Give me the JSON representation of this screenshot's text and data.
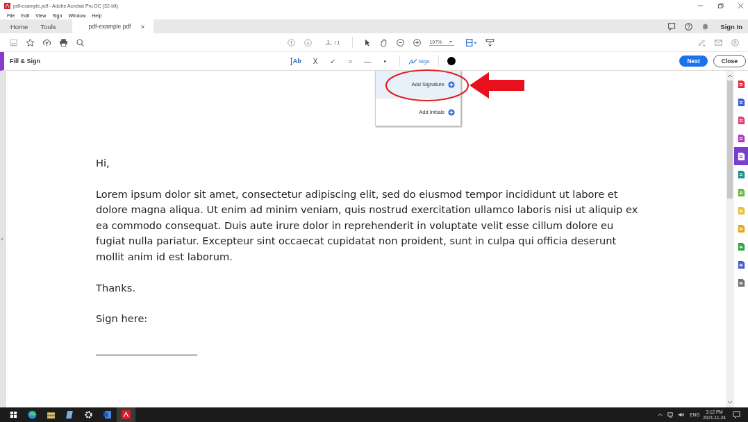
{
  "window": {
    "title": "pdf-example.pdf - Adobe Acrobat Pro DC (32-bit)"
  },
  "menu": [
    "File",
    "Edit",
    "View",
    "Sign",
    "Window",
    "Help"
  ],
  "tabs": [
    {
      "label": "Home",
      "selected": false
    },
    {
      "label": "Tools",
      "selected": false
    },
    {
      "label": "pdf-example.pdf",
      "selected": true
    }
  ],
  "sign_in": "Sign In",
  "toolbar": {
    "page": "1",
    "page_total": "/ 1",
    "zoom": "197%"
  },
  "fill_sign": {
    "title": "Fill & Sign",
    "text_tool": "Ab",
    "tools": [
      "X",
      "✓",
      "○",
      "—",
      "•"
    ],
    "sign": "Sign",
    "next": "Next",
    "close": "Close"
  },
  "dropdown": [
    {
      "label": "Add Signature",
      "selected": true
    },
    {
      "label": "Add Initials",
      "selected": false
    }
  ],
  "document": {
    "greeting": "Hi,",
    "paragraph": "Lorem ipsum dolor sit amet, consectetur adipiscing elit, sed do eiusmod tempor incididunt ut labore et dolore magna aliqua. Ut enim ad minim veniam, quis nostrud exercitation ullamco laboris nisi ut aliquip ex ea commodo consequat. Duis aute irure dolor in reprehenderit in voluptate velit esse cillum dolore eu fugiat nulla pariatur. Excepteur sint occaecat cupidatat non proident, sunt in culpa qui officia deserunt mollit anim id est laborum.",
    "closing": "Thanks.",
    "sign_here": "Sign here:",
    "signature_line": "____________________"
  },
  "right_panel": [
    {
      "color": "#e0303a",
      "selected": false
    },
    {
      "color": "#3b5bdb",
      "selected": false
    },
    {
      "color": "#e0407a",
      "selected": false
    },
    {
      "color": "#b03ac0",
      "selected": false
    },
    {
      "color": "#7b3fd0",
      "selected": true
    },
    {
      "color": "#1e8a8a",
      "selected": false
    },
    {
      "color": "#6ab640",
      "selected": false
    },
    {
      "color": "#e8c040",
      "selected": false
    },
    {
      "color": "#e0a820",
      "selected": false
    },
    {
      "color": "#30a040",
      "selected": false
    },
    {
      "color": "#4060c8",
      "selected": false
    },
    {
      "color": "#707070",
      "selected": false
    }
  ],
  "taskbar": {
    "apps": [
      {
        "kind": "edge",
        "active": false
      },
      {
        "kind": "folder",
        "active": false
      },
      {
        "kind": "notepad",
        "active": false
      },
      {
        "kind": "gear",
        "active": false
      },
      {
        "kind": "word",
        "active": false
      },
      {
        "kind": "acrobat",
        "active": true
      }
    ],
    "language": "ENG",
    "time": "3:12 PM",
    "date": "2021-11-24"
  }
}
